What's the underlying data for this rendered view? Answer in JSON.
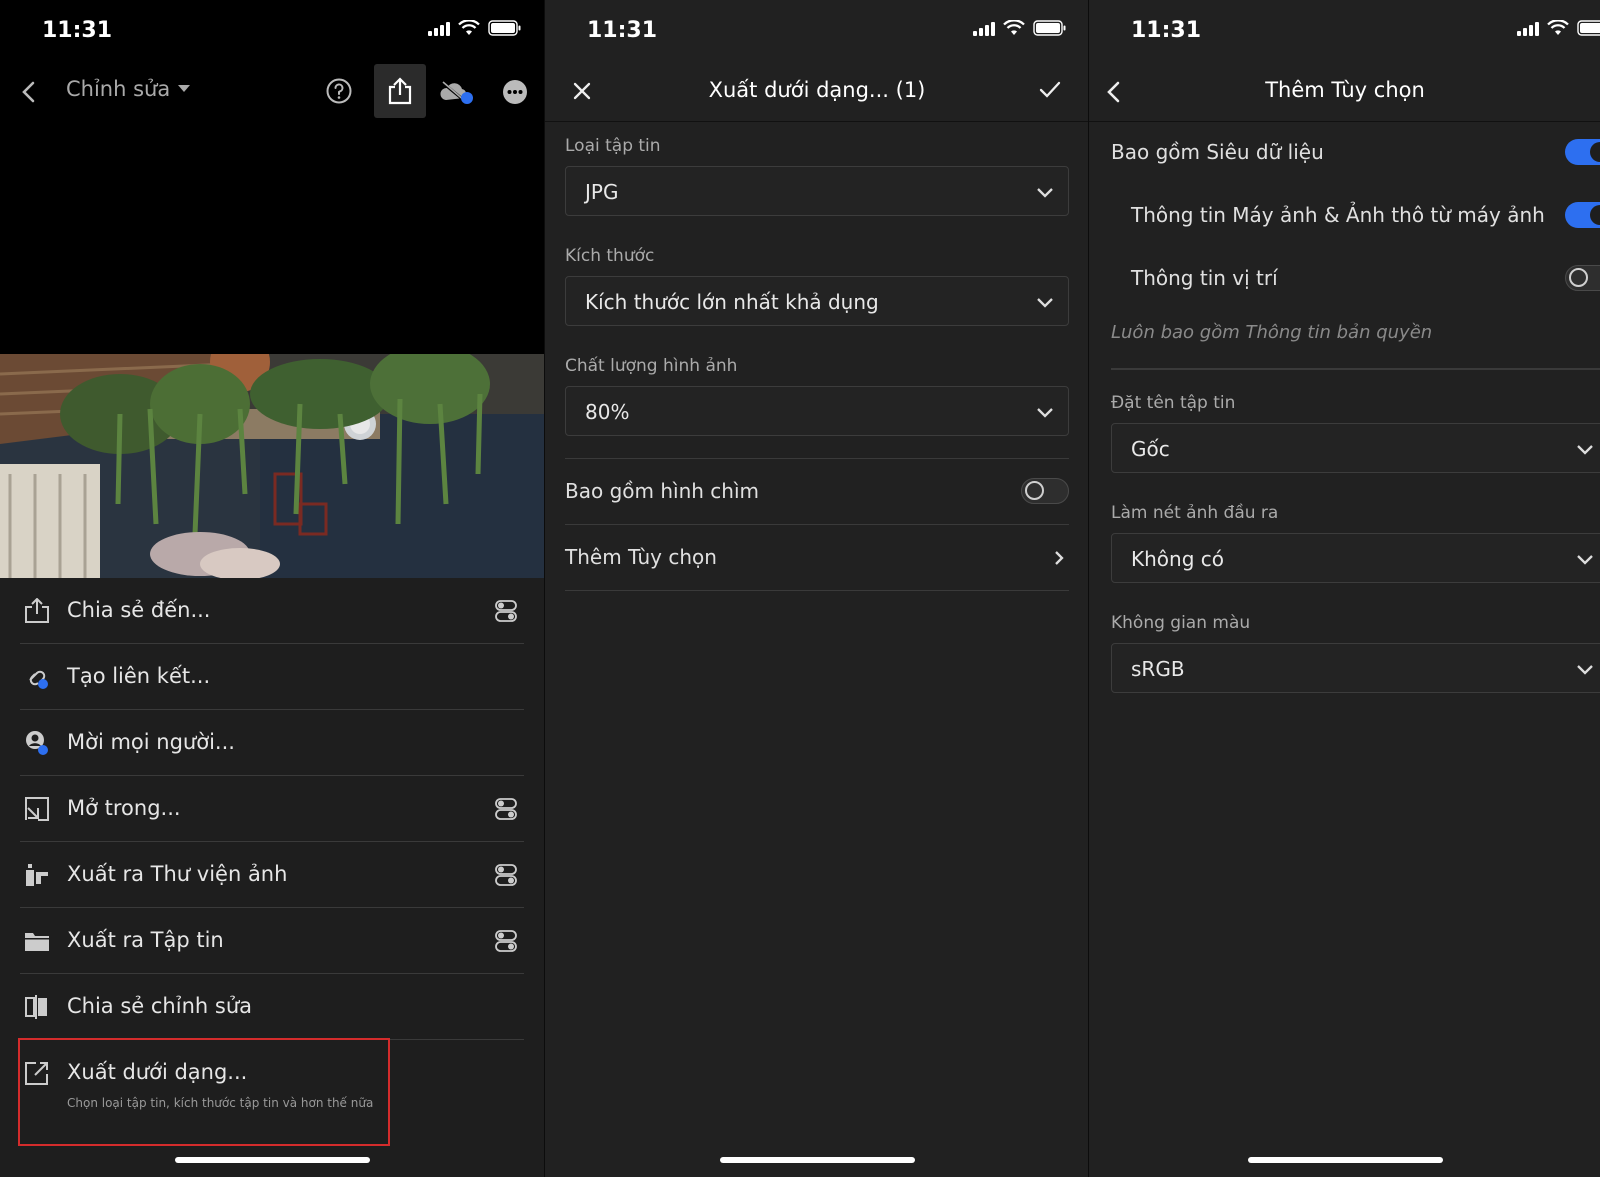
{
  "status": {
    "time": "11:31"
  },
  "panel1": {
    "nav_title": "Chỉnh sửa",
    "menu": [
      {
        "label": "Chia sẻ đến..."
      },
      {
        "label": "Tạo liên kết..."
      },
      {
        "label": "Mời mọi người..."
      },
      {
        "label": "Mở trong..."
      },
      {
        "label": "Xuất ra Thư viện ảnh"
      },
      {
        "label": "Xuất ra Tập tin"
      },
      {
        "label": "Chia sẻ chỉnh sửa"
      },
      {
        "label": "Xuất dưới dạng...",
        "sublabel": "Chọn loại tập tin, kích thước tập tin và hơn thế nữa"
      }
    ]
  },
  "panel2": {
    "title": "Xuất dưới dạng... (1)",
    "file_type": {
      "label": "Loại tập tin",
      "value": "JPG"
    },
    "size": {
      "label": "Kích thước",
      "value": "Kích thước lớn nhất khả dụng"
    },
    "quality": {
      "label": "Chất lượng hình ảnh",
      "value": "80%"
    },
    "watermark": {
      "label": "Bao gồm hình chìm",
      "on": false
    },
    "more_options": {
      "label": "Thêm Tùy chọn"
    }
  },
  "panel3": {
    "title": "Thêm Tùy chọn",
    "metadata": {
      "label": "Bao gồm Siêu dữ liệu",
      "on": true
    },
    "camera_info": {
      "label": "Thông tin Máy ảnh & Ảnh thô từ máy ảnh",
      "on": true
    },
    "location_info": {
      "label": "Thông tin vị trí",
      "on": false
    },
    "copyright_note": "Luôn bao gồm Thông tin bản quyền",
    "file_naming": {
      "label": "Đặt tên tập tin",
      "value": "Gốc"
    },
    "sharpen": {
      "label": "Làm nét ảnh đầu ra",
      "value": "Không có"
    },
    "color_space": {
      "label": "Không gian màu",
      "value": "sRGB"
    }
  },
  "colors": {
    "accent": "#2d6ff0",
    "highlight": "#d42c2c",
    "background": "#212121"
  }
}
